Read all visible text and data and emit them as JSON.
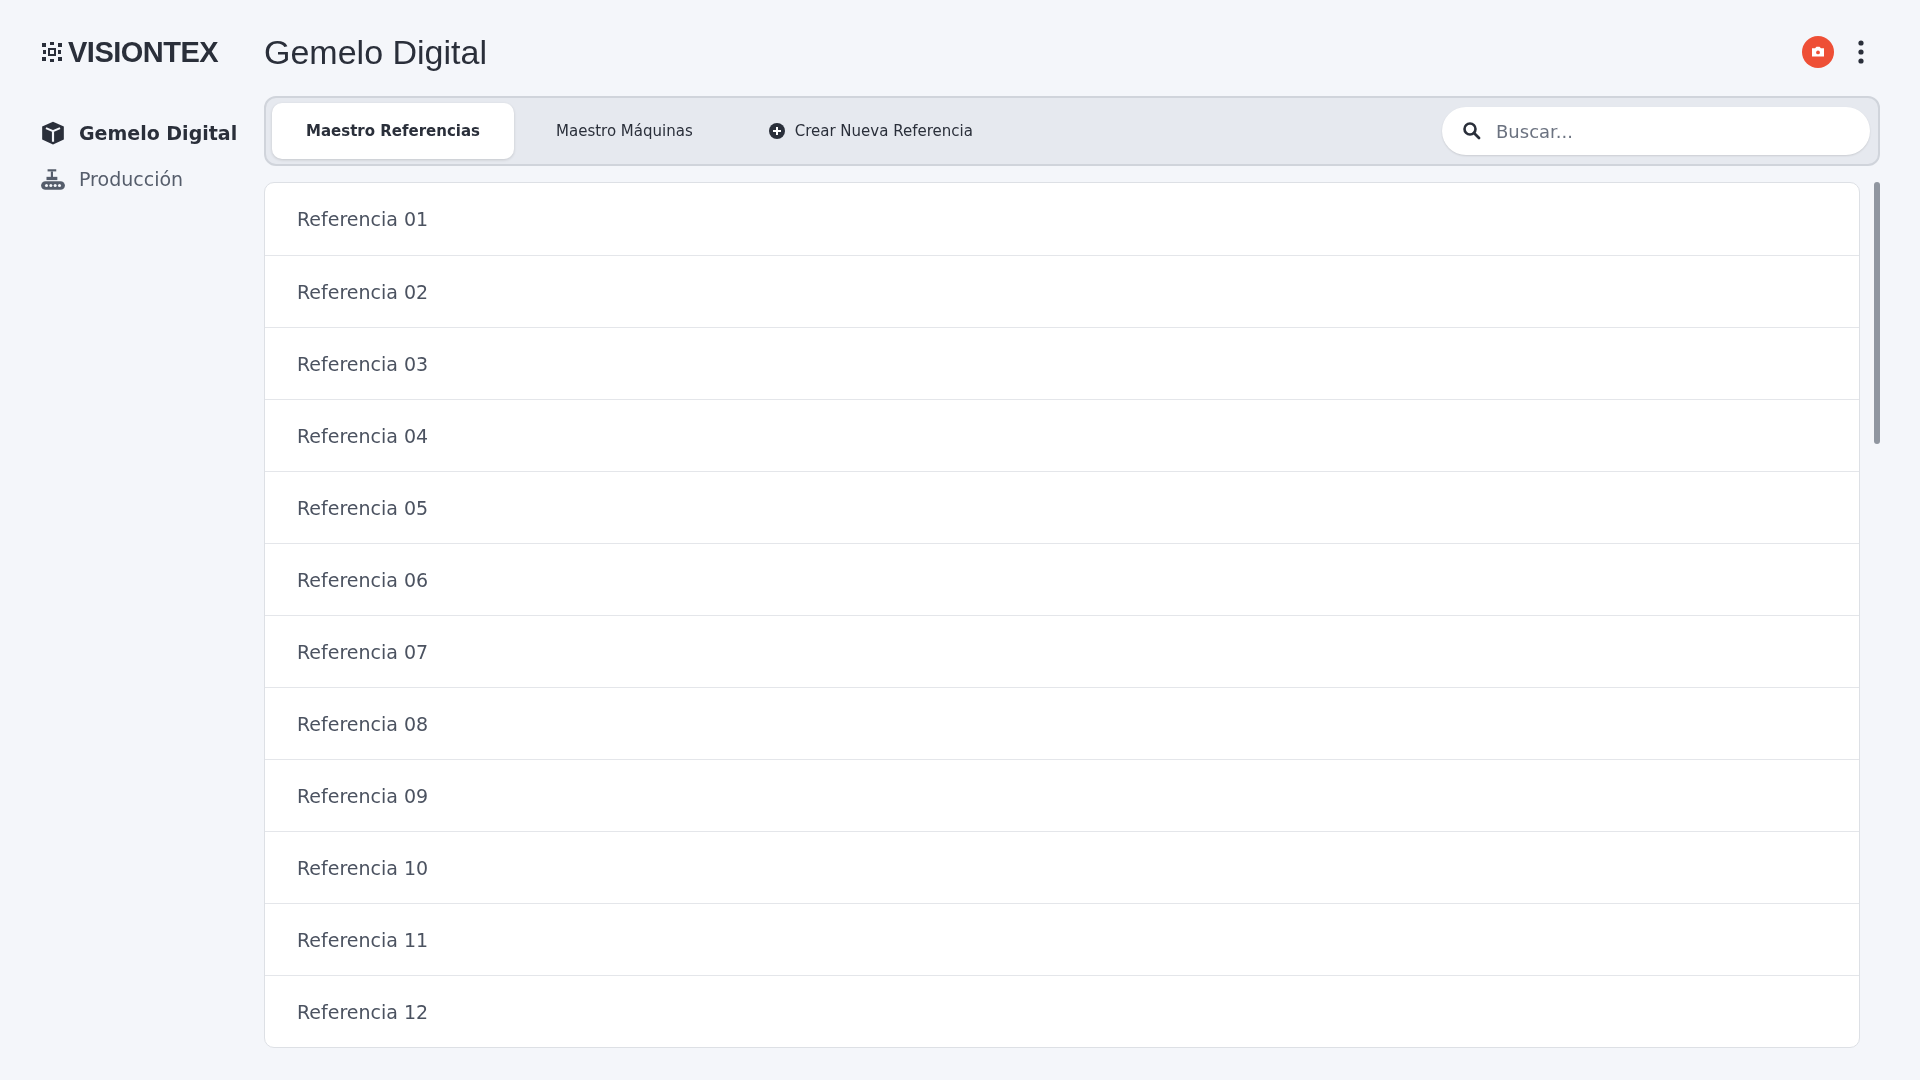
{
  "brand": {
    "name": "VISIONTEX"
  },
  "page_title": "Gemelo Digital",
  "sidebar": {
    "items": [
      {
        "label": "Gemelo Digital",
        "kind": "model",
        "selected": true
      },
      {
        "label": "Producción",
        "kind": "production",
        "selected": false
      }
    ]
  },
  "tabs": [
    {
      "label": "Maestro Referencias",
      "kind": "tab",
      "selected": true
    },
    {
      "label": "Maestro Máquinas",
      "kind": "tab",
      "selected": false
    },
    {
      "label": "Crear Nueva Referencia",
      "kind": "action",
      "selected": false
    }
  ],
  "search": {
    "placeholder": "Buscar..."
  },
  "list": {
    "items": [
      "Referencia 01",
      "Referencia 02",
      "Referencia 03",
      "Referencia 04",
      "Referencia 05",
      "Referencia 06",
      "Referencia 07",
      "Referencia 08",
      "Referencia 09",
      "Referencia 10",
      "Referencia 11",
      "Referencia 12"
    ]
  }
}
